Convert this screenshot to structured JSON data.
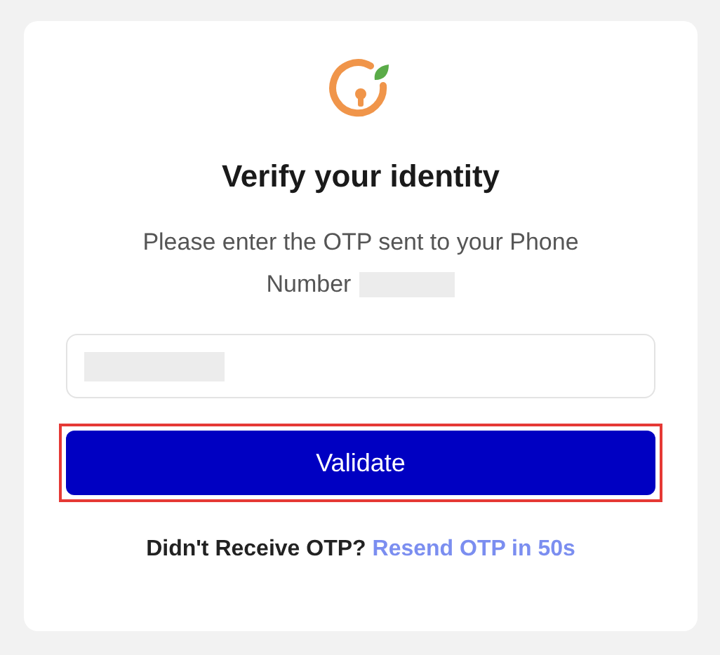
{
  "title": "Verify your identity",
  "message_lines": [
    "Please enter the OTP sent to your Phone",
    "Number"
  ],
  "button": {
    "label": "Validate",
    "highlighted": true
  },
  "footer": {
    "question": "Didn't Receive OTP?",
    "link": "Resend OTP in 50s"
  }
}
